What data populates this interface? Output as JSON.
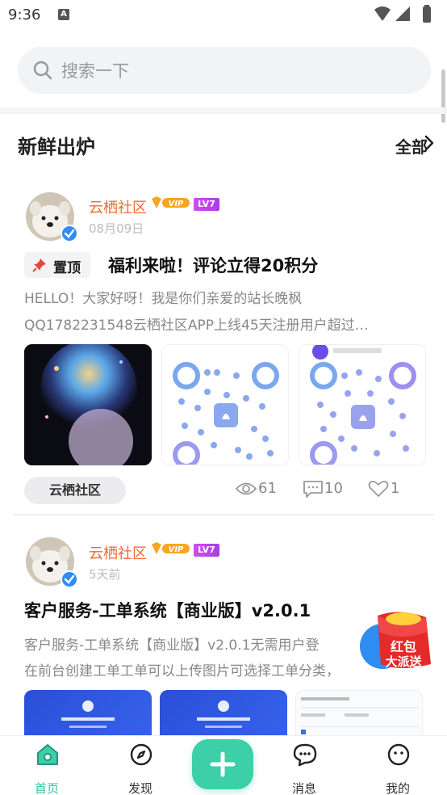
{
  "status_bar": {
    "time": "9:36",
    "app_icon_letter": "A"
  },
  "search": {
    "placeholder": "搜索一下"
  },
  "section": {
    "title": "新鲜出炉",
    "all_label": "全部"
  },
  "posts": [
    {
      "author": "云栖社区",
      "level": "LV7",
      "date": "08月09日",
      "pinned_label": "置顶",
      "title": "福利来啦！评论立得20积分",
      "excerpt_line1": "HELLO！大家好呀！我是你们亲爱的站长晚枫",
      "excerpt_line2": "QQ1782231548云栖社区APP上线45天注册用户超过…",
      "tag": "云栖社区",
      "views": "61",
      "comments": "10",
      "likes": "1"
    },
    {
      "author": "云栖社区",
      "level": "LV7",
      "date": "5天前",
      "title": "客户服务-工单系统【商业版】v2.0.1",
      "excerpt_line1": "客户服务-工单系统【商业版】v2.0.1无需用户登",
      "excerpt_line2": "在前台创建工单工单可以上传图片可选择工单分类，"
    }
  ],
  "red_packet": {
    "line1": "红包",
    "line2": "大派送"
  },
  "tabbar": {
    "items": [
      {
        "label": "首页",
        "icon": "home-icon",
        "active": true
      },
      {
        "label": "发现",
        "icon": "compass-icon",
        "active": false
      },
      {
        "label": "消息",
        "icon": "chat-icon",
        "active": false
      },
      {
        "label": "我的",
        "icon": "profile-icon",
        "active": false
      }
    ]
  },
  "colors": {
    "accent": "#3dcfa8",
    "author": "#f06b32",
    "verified": "#2f8cf0"
  }
}
